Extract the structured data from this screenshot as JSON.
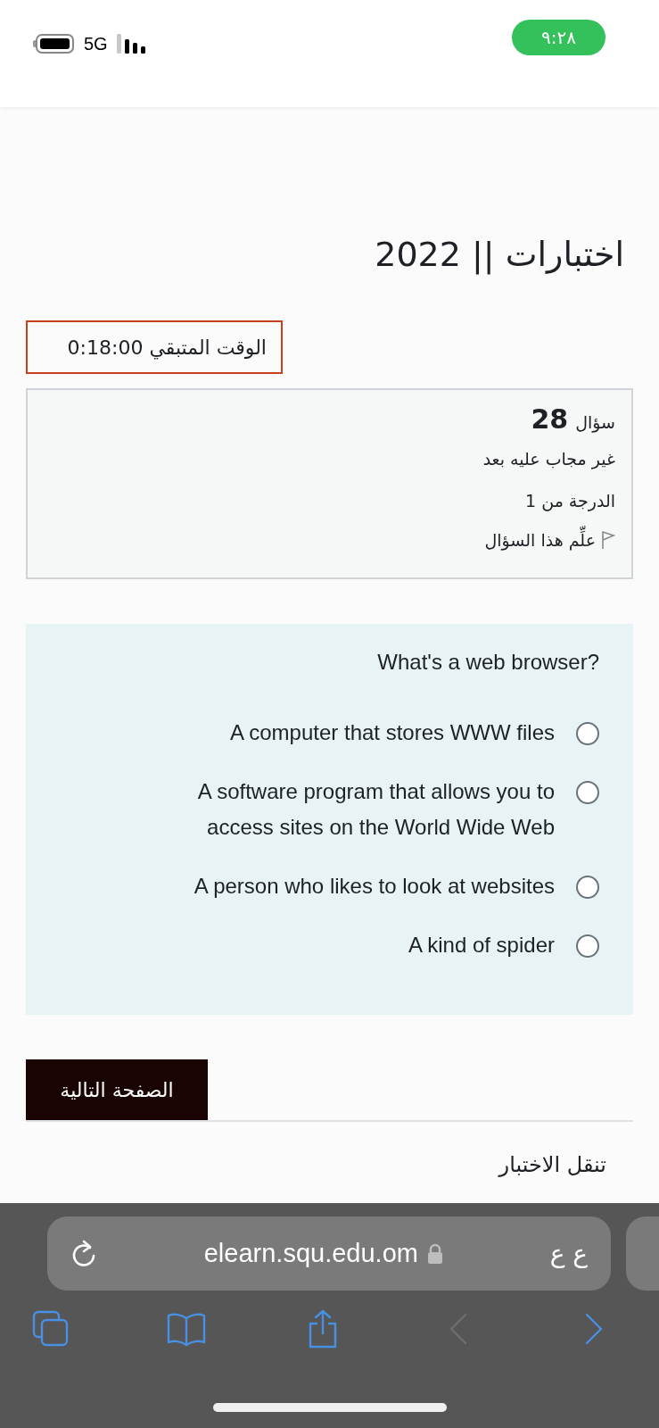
{
  "status_bar": {
    "network": "5G",
    "time": "٩:٢٨"
  },
  "page_title": "اختبارات || 2022",
  "timer": {
    "label": "الوقت المتبقي",
    "value": "0:18:00"
  },
  "question_info": {
    "label": "سؤال",
    "number": "28",
    "status": "غير مجاب عليه بعد",
    "grade": "الدرجة من 1",
    "flag": "علِّم هذا السؤال"
  },
  "question": {
    "text": "What's a web browser?",
    "answers": [
      {
        "text": "A computer that stores WWW files",
        "selected": false
      },
      {
        "text": "A software program that allows you to access sites on the World Wide Web",
        "selected": false
      },
      {
        "text": "A person who likes to look at websites",
        "selected": false
      },
      {
        "text": "A kind of spider",
        "selected": false
      }
    ]
  },
  "next_button": "الصفحة التالية",
  "quiz_navigation": "تنقل الاختبار",
  "browser": {
    "url": "elearn.squ.edu.om",
    "text_size": "ع ع",
    "toolbar": [
      {
        "kind": "tabs",
        "disabled": false
      },
      {
        "kind": "bookmarks",
        "disabled": false
      },
      {
        "kind": "share",
        "disabled": false
      },
      {
        "kind": "back",
        "disabled": true
      },
      {
        "kind": "forward",
        "disabled": false
      }
    ]
  }
}
